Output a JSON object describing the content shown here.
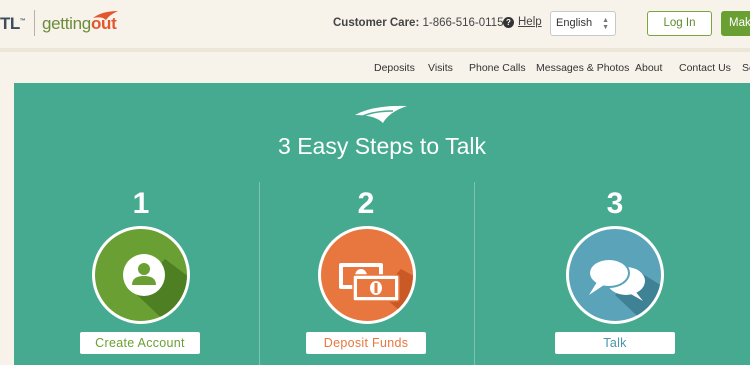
{
  "brand": {
    "tl_text": "TL",
    "tm": "™",
    "word_plain": "getting",
    "word_bold": "out"
  },
  "header": {
    "care_label": "Customer Care:",
    "care_phone": "1-866-516-0115",
    "help_label": "Help",
    "language": "English",
    "login_label": "Log In",
    "make_label": "Mak"
  },
  "nav": {
    "items": [
      {
        "label": "Deposits"
      },
      {
        "label": "Visits"
      },
      {
        "label": "Phone Calls"
      },
      {
        "label": "Messages & Photos"
      },
      {
        "label": "About"
      },
      {
        "label": "Contact Us"
      },
      {
        "label": "Se"
      }
    ]
  },
  "main": {
    "heading": "3 Easy Steps to Talk",
    "steps": [
      {
        "number": "1",
        "button": "Create Account",
        "color": "#6aa033",
        "icon": "user-icon"
      },
      {
        "number": "2",
        "button": "Deposit Funds",
        "color": "#e8773f",
        "icon": "money-icon"
      },
      {
        "number": "3",
        "button": "Talk",
        "color": "#5aa3b8",
        "icon": "chat-icon"
      }
    ]
  },
  "colors": {
    "panel": "#45aa8f",
    "background": "#f7f3ea",
    "green": "#6aa033",
    "orange": "#e8773f",
    "teal": "#5aa3b8"
  }
}
